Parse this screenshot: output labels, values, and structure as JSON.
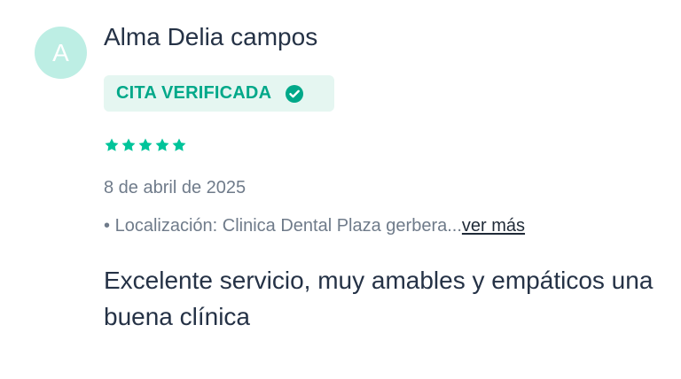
{
  "review": {
    "avatar_initial": "A",
    "author_name": "Alma Delia campos",
    "badge": {
      "label": "CITA VERIFICADA",
      "icon": "check-circle-icon",
      "text_color": "#00a889",
      "background_color": "#e5f6f1"
    },
    "rating": {
      "value": 5,
      "max": 5,
      "icon": "star-icon",
      "color": "#00c49a"
    },
    "date": "8 de abril de 2025",
    "location": {
      "bullet": "•",
      "text": "Localización: Clinica Dental Plaza gerbera...",
      "link_label": "ver más"
    },
    "comment": "Excelente servicio, muy amables y empáticos una buena clínica"
  },
  "colors": {
    "avatar_background": "#bdeee4",
    "accent": "#00a889",
    "text_primary": "#253246",
    "text_secondary": "#6f7b8a"
  }
}
